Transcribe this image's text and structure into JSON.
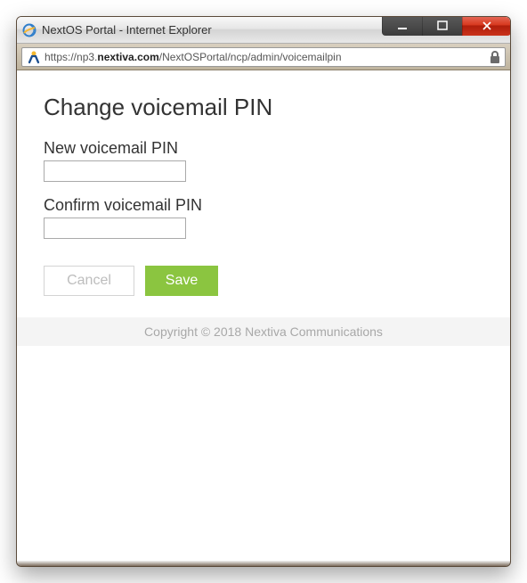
{
  "window": {
    "title": "NextOS Portal - Internet Explorer"
  },
  "address": {
    "prefix": "https://np3.",
    "domain": "nextiva.com",
    "path": "/NextOSPortal/ncp/admin/voicemailpin"
  },
  "page": {
    "heading": "Change voicemail PIN",
    "field_new_label": "New voicemail PIN",
    "field_confirm_label": "Confirm voicemail PIN",
    "cancel_label": "Cancel",
    "save_label": "Save"
  },
  "footer": {
    "copyright": "Copyright © 2018 Nextiva Communications"
  },
  "colors": {
    "save_bg": "#8bc540"
  }
}
